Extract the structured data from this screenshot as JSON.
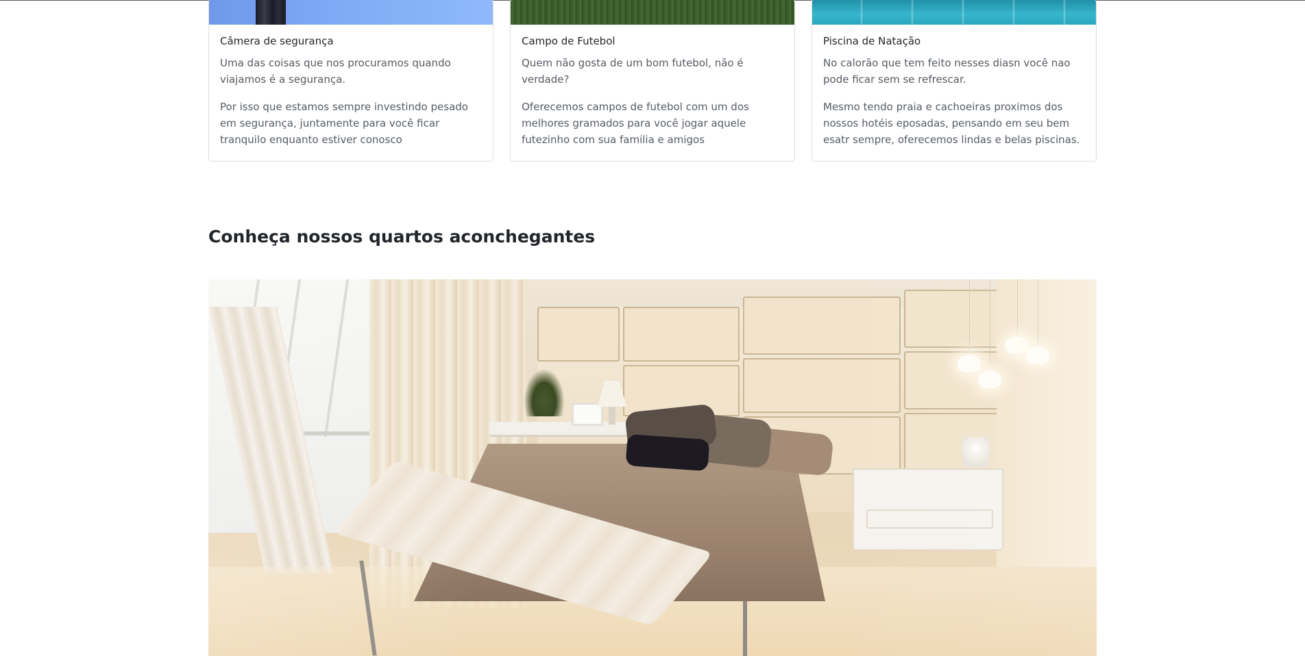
{
  "cards": [
    {
      "title": "Câmera de segurança",
      "paragraph1": "Uma das coisas que nos procuramos quando viajamos é a segurança.",
      "paragraph2": "Por isso que estamos sempre investindo pesado em segurança, juntamente para você ficar tranquilo enquanto estiver conosco"
    },
    {
      "title": "Campo de Futebol",
      "paragraph1": "Quem não gosta de um bom futebol, não é verdade?",
      "paragraph2": "Oferecemos campos de futebol com um dos melhores gramados para você jogar aquele futezinho com sua familia e amigos"
    },
    {
      "title": "Piscina de Natação",
      "paragraph1": "No calorão que tem feito nesses diasn você nao pode ficar sem se refrescar.",
      "paragraph2": "Mesmo tendo praia e cachoeiras proximos dos nossos hotéis eposadas, pensando em seu bem esatr sempre, oferecemos lindas e belas piscinas."
    }
  ],
  "rooms_section": {
    "title": "Conheça nossos quartos aconchegantes"
  }
}
